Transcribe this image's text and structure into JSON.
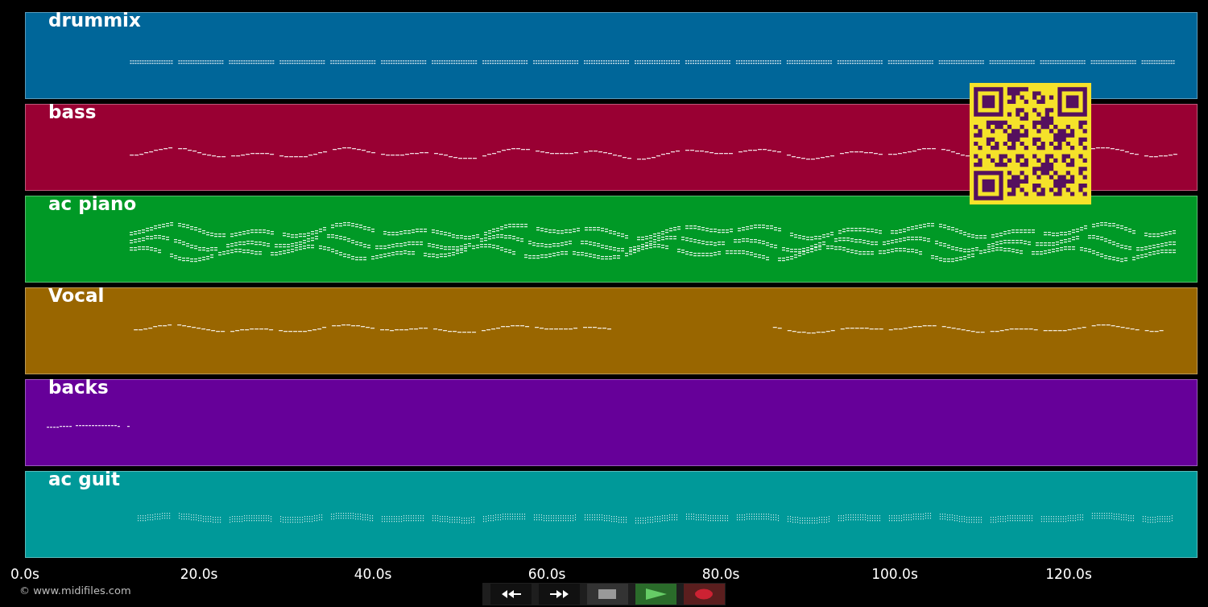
{
  "tracks": [
    {
      "name": "drummix",
      "color": "#006699"
    },
    {
      "name": "bass",
      "color": "#990033"
    },
    {
      "name": "ac piano",
      "color": "#009926"
    },
    {
      "name": "Vocal",
      "color": "#996600"
    },
    {
      "name": "backs",
      "color": "#660099"
    },
    {
      "name": "ac guit",
      "color": "#009999"
    }
  ],
  "axis": {
    "ticks": [
      "0.0s",
      "20.0s",
      "40.0s",
      "60.0s",
      "80.0s",
      "100.0s",
      "120.0s"
    ]
  },
  "transport": [
    {
      "kind": "rewind"
    },
    {
      "kind": "forward"
    },
    {
      "kind": "stop"
    },
    {
      "kind": "play"
    },
    {
      "kind": "record"
    }
  ],
  "credit": "© www.midifiles.com"
}
